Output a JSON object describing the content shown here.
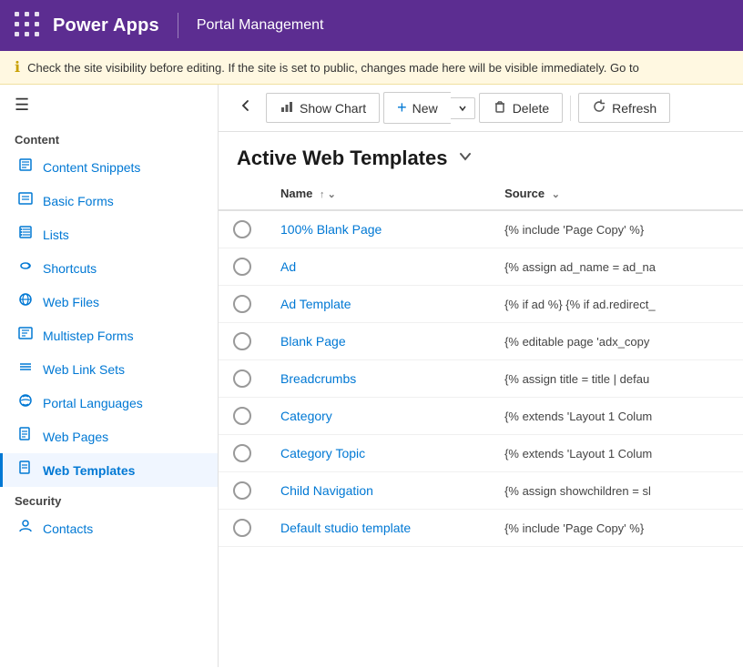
{
  "topbar": {
    "app_name": "Power Apps",
    "page_title": "Portal Management"
  },
  "infobar": {
    "message": "Check the site visibility before editing. If the site is set to public, changes made here will be visible immediately. Go to"
  },
  "toolbar": {
    "back_label": "‹",
    "show_chart_label": "Show Chart",
    "new_label": "New",
    "delete_label": "Delete",
    "refresh_label": "Refresh"
  },
  "page_header": {
    "title": "Active Web Templates",
    "dropdown_icon": "⌄"
  },
  "table": {
    "columns": [
      {
        "id": "select",
        "label": ""
      },
      {
        "id": "name",
        "label": "Name",
        "sortable": true
      },
      {
        "id": "source",
        "label": "Source",
        "sortable": true
      }
    ],
    "rows": [
      {
        "name": "100% Blank Page",
        "source": "{% include 'Page Copy' %}"
      },
      {
        "name": "Ad",
        "source": "{% assign ad_name = ad_na"
      },
      {
        "name": "Ad Template",
        "source": "{% if ad %} {% if ad.redirect_"
      },
      {
        "name": "Blank Page",
        "source": "{% editable page 'adx_copy"
      },
      {
        "name": "Breadcrumbs",
        "source": "{% assign title = title | defau"
      },
      {
        "name": "Category",
        "source": "{% extends 'Layout 1 Colum"
      },
      {
        "name": "Category Topic",
        "source": "{% extends 'Layout 1 Colum"
      },
      {
        "name": "Child Navigation",
        "source": "{% assign showchildren = sl"
      },
      {
        "name": "Default studio template",
        "source": "{% include 'Page Copy' %}"
      }
    ]
  },
  "sidebar": {
    "content_section": "Content",
    "items": [
      {
        "id": "content-snippets",
        "label": "Content Snippets",
        "icon": "📄"
      },
      {
        "id": "basic-forms",
        "label": "Basic Forms",
        "icon": "📋"
      },
      {
        "id": "lists",
        "label": "Lists",
        "icon": "📃"
      },
      {
        "id": "shortcuts",
        "label": "Shortcuts",
        "icon": "🔗"
      },
      {
        "id": "web-files",
        "label": "Web Files",
        "icon": "🌐"
      },
      {
        "id": "multistep-forms",
        "label": "Multistep Forms",
        "icon": "📝"
      },
      {
        "id": "web-link-sets",
        "label": "Web Link Sets",
        "icon": "🔗"
      },
      {
        "id": "portal-languages",
        "label": "Portal Languages",
        "icon": "🌍"
      },
      {
        "id": "web-pages",
        "label": "Web Pages",
        "icon": "📄"
      },
      {
        "id": "web-templates",
        "label": "Web Templates",
        "icon": "📄",
        "active": true
      }
    ],
    "security_section": "Security",
    "security_items": [
      {
        "id": "contacts",
        "label": "Contacts",
        "icon": "👤"
      }
    ]
  },
  "icons": {
    "grid_dots": "⠿",
    "hamburger": "≡",
    "info": "ℹ",
    "chart_icon": "📊",
    "plus_icon": "+",
    "delete_icon": "🗑",
    "refresh_icon": "↻",
    "chevron_down": "⌄",
    "back_arrow": "←",
    "sort_asc": "↑",
    "sort_filter": "↑↓"
  }
}
